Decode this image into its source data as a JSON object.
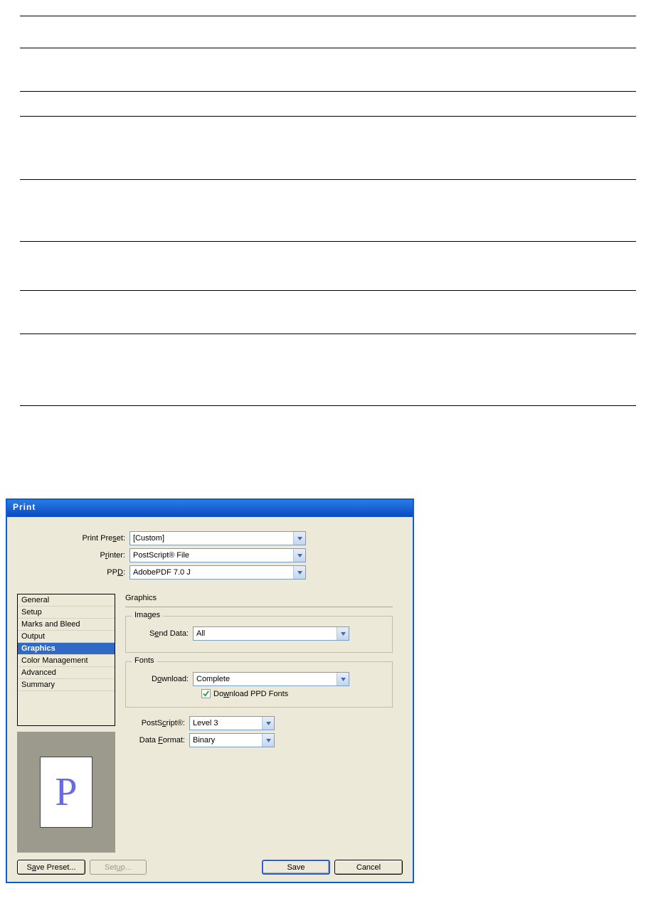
{
  "titlebar": "Print",
  "top": {
    "preset_label": "Print Preset:",
    "preset_value": "[Custom]",
    "printer_label_pre": "P",
    "printer_label_u": "r",
    "printer_label_post": "inter:",
    "printer_value": "PostScript® File",
    "ppd_label_pre": "PP",
    "ppd_label_u": "D",
    "ppd_label_post": ":",
    "ppd_value": "AdobePDF 7.0 J"
  },
  "sidebar": {
    "items": [
      "General",
      "Setup",
      "Marks and Bleed",
      "Output",
      "Graphics",
      "Color Management",
      "Advanced",
      "Summary"
    ],
    "selected_index": 4
  },
  "panel": {
    "heading": "Graphics",
    "images_group": "Images",
    "send_data_label": "Send Data:",
    "send_data_value": "All",
    "fonts_group": "Fonts",
    "download_label_pre": "D",
    "download_label_u": "o",
    "download_label_post": "wnload:",
    "download_value": "Complete",
    "chk_pre": "Do",
    "chk_u": "w",
    "chk_post": "nload PPD Fonts",
    "ps_label_pre": "PostS",
    "ps_label_u": "c",
    "ps_label_post": "ript®:",
    "ps_value": "Level 3",
    "df_label_pre": "Data ",
    "df_label_u": "F",
    "df_label_post": "ormat:",
    "df_value": "Binary"
  },
  "preview_letter": "P",
  "buttons": {
    "save_preset_pre": "S",
    "save_preset_u": "a",
    "save_preset_post": "ve Preset...",
    "setup_pre": "Set",
    "setup_u": "u",
    "setup_post": "p...",
    "save": "Save",
    "cancel": "Cancel"
  }
}
